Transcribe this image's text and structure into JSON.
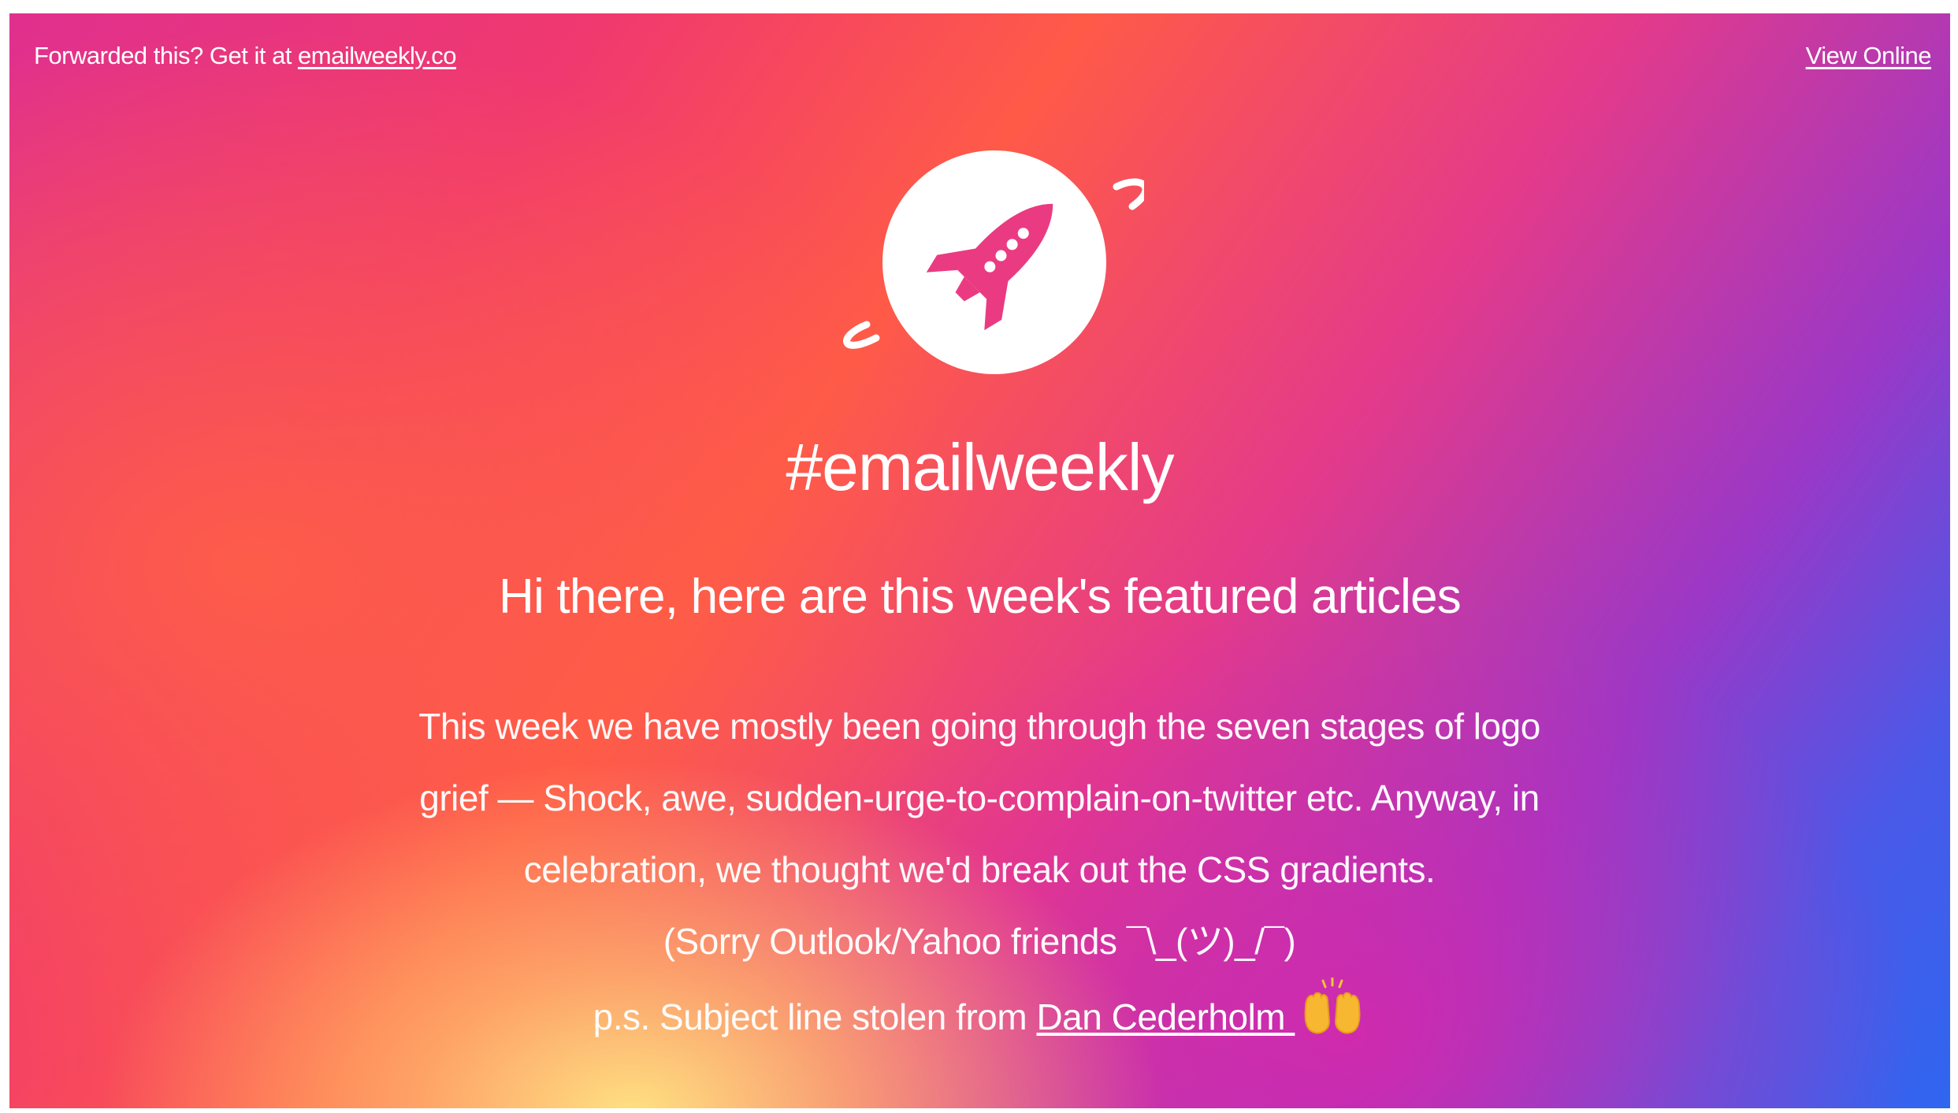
{
  "topbar": {
    "forward_prefix": "Forwarded this? Get it at ",
    "forward_link": "emailweekly.co",
    "view_online": "View Online"
  },
  "header": {
    "logo_icon": "rocket-planet-icon",
    "brand": "#emailweekly",
    "subtitle": "Hi there, here are this week's featured articles"
  },
  "intro": {
    "line1": "This week we have mostly been going through the seven stages of logo",
    "line2": "grief — Shock, awe, sudden-urge-to-complain-on-twitter etc. Anyway, in",
    "line3": "celebration, we thought we'd break out the CSS gradients.",
    "line4": "(Sorry Outlook/Yahoo friends  ¯\\_(ツ)_/¯)",
    "ps_prefix": "p.s. Subject line stolen from ",
    "ps_link": "Dan Cederholm ",
    "ps_emoji": "raised-hands-icon"
  },
  "colors": {
    "text": "#ffffff",
    "gradient_pink": "#e0308e",
    "gradient_orange": "#ff5a48",
    "gradient_purple": "#9a38c7",
    "gradient_blue": "#2f66f0",
    "gradient_yellow": "#ffea82"
  }
}
